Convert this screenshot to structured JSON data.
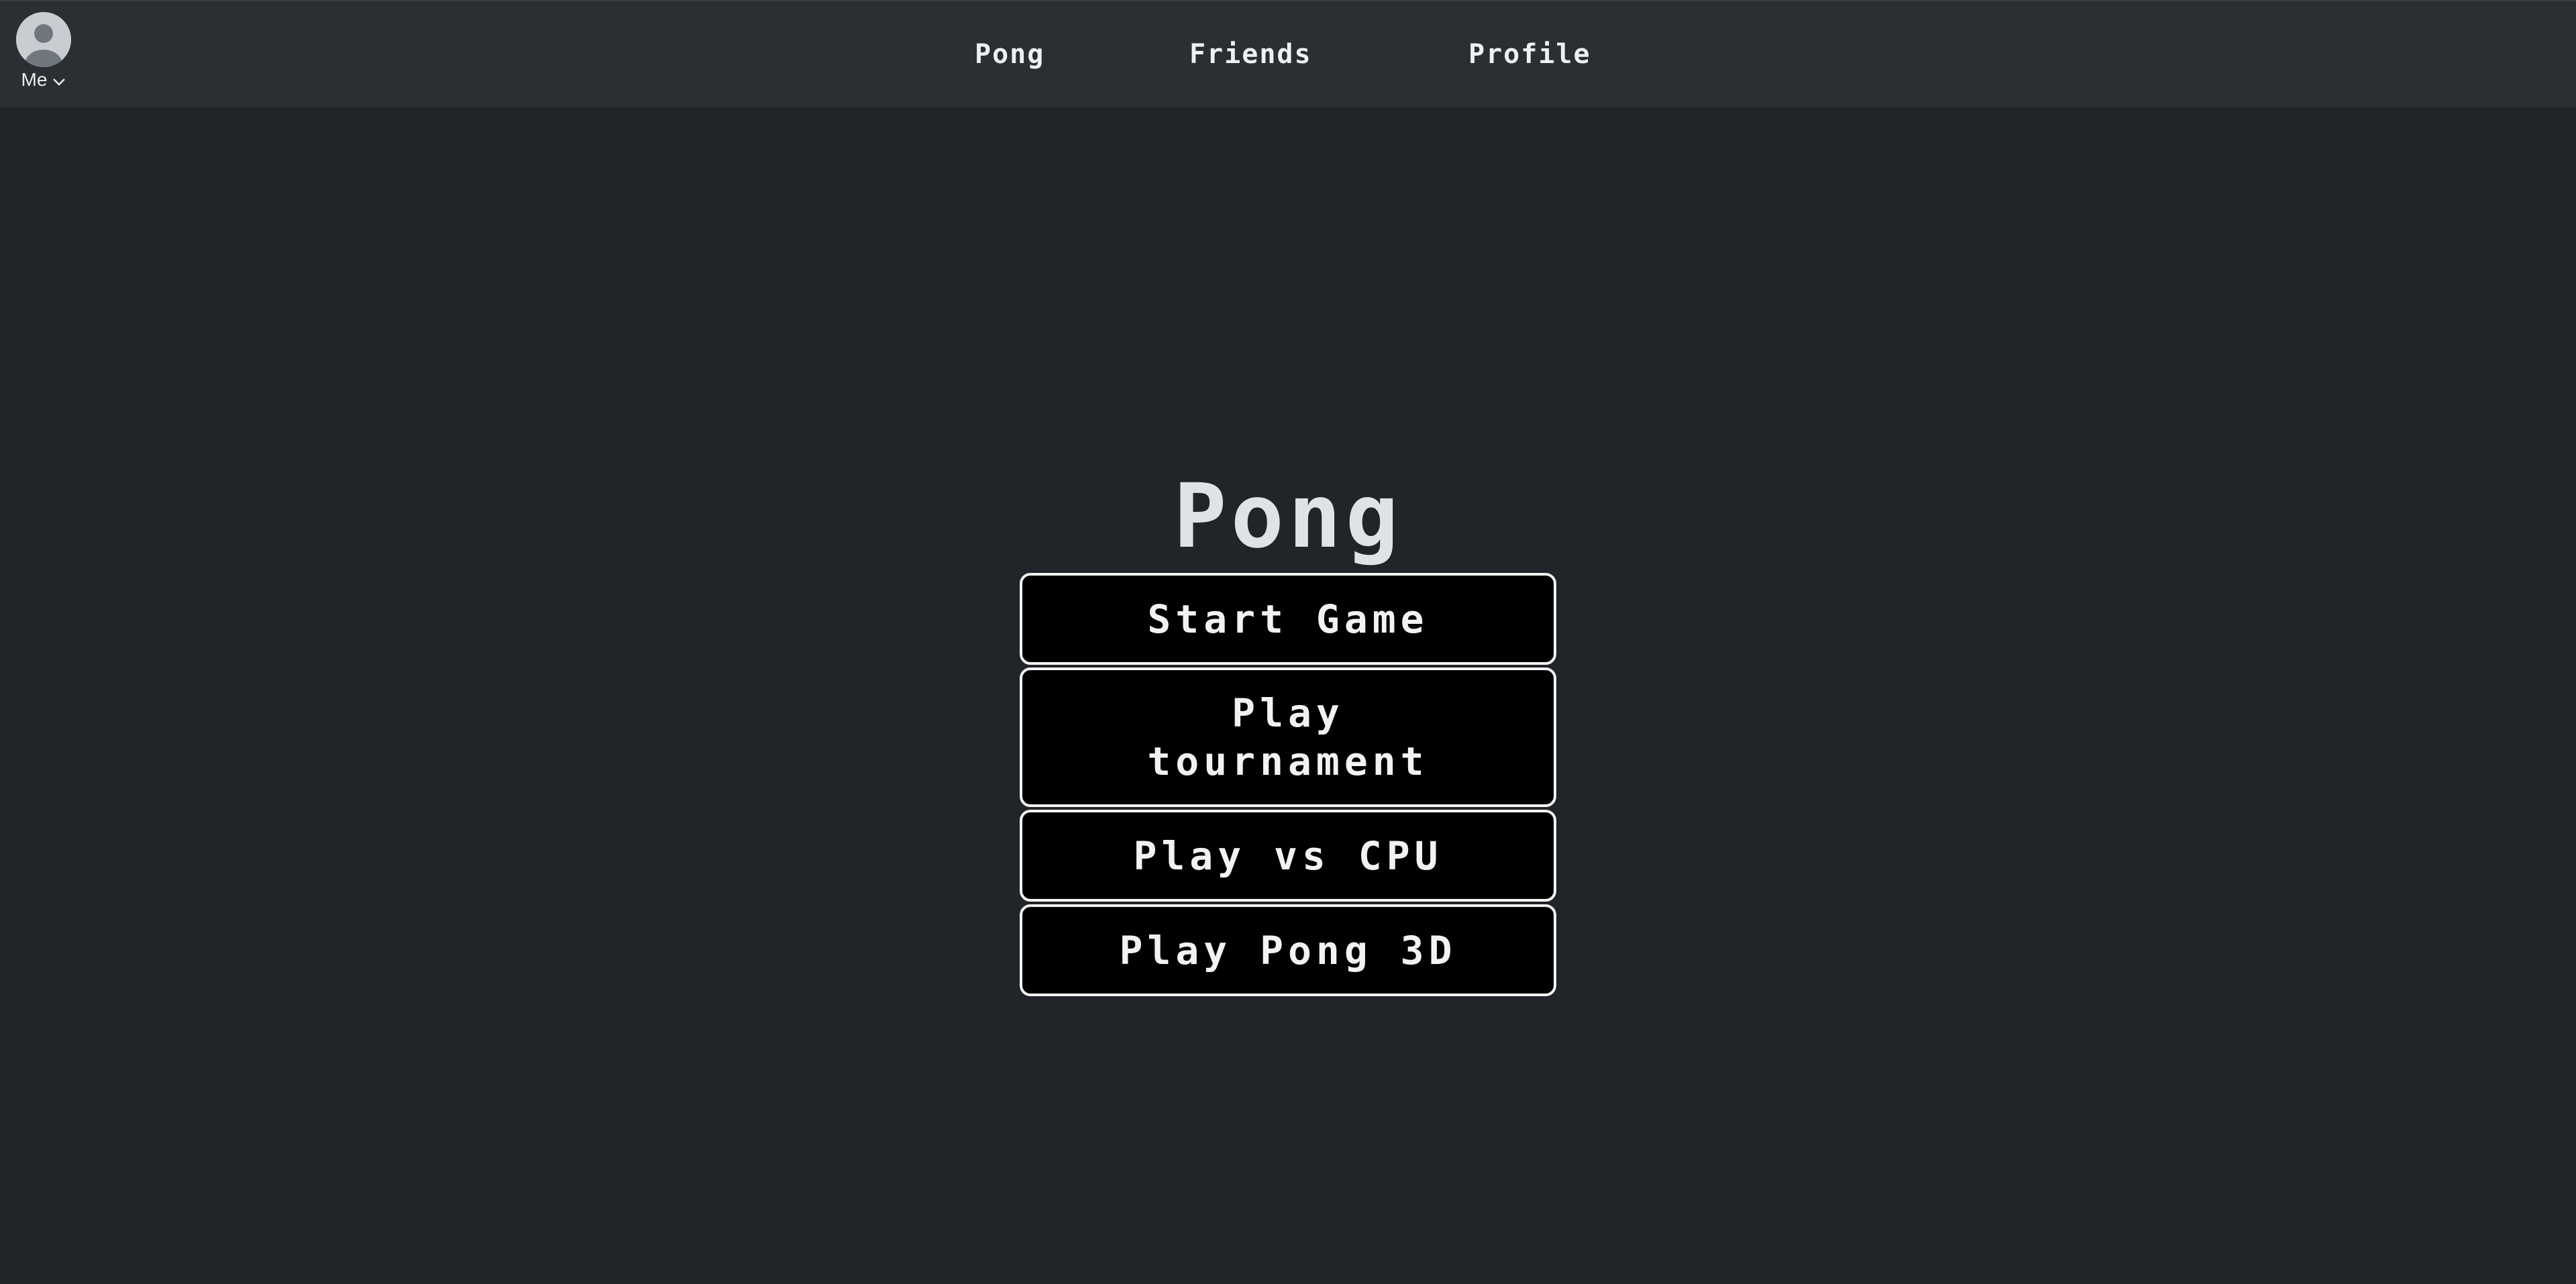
{
  "user_menu": {
    "label": "Me",
    "avatar_icon": "user-avatar-icon",
    "chevron_icon": "chevron-down-icon"
  },
  "nav": {
    "items": [
      {
        "label": "Pong"
      },
      {
        "label": "Friends"
      },
      {
        "label": "Profile"
      }
    ]
  },
  "main": {
    "title": "Pong",
    "buttons": [
      {
        "label": "Start Game"
      },
      {
        "label": "Play tournament"
      },
      {
        "label": "Play vs CPU"
      },
      {
        "label": "Play Pong 3D"
      }
    ]
  },
  "colors": {
    "page_background": "#212429",
    "navbar_background": "#2b2f33",
    "button_background": "#000000",
    "button_border": "#f4f4f4",
    "text": "#eef0f2"
  }
}
